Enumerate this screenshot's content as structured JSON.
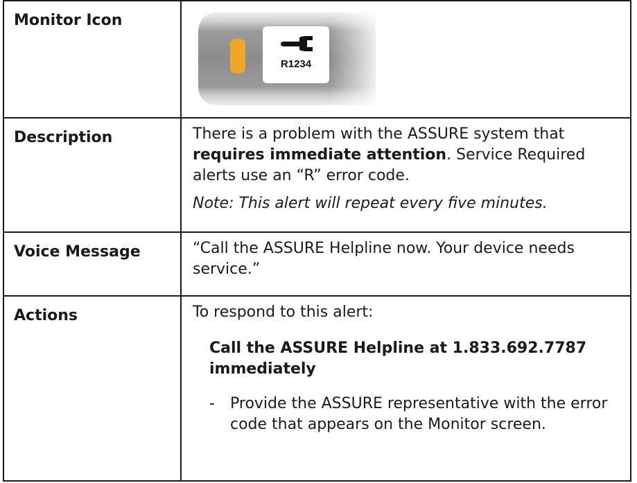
{
  "rows": {
    "monitor_icon": {
      "label": "Monitor Icon",
      "device": {
        "icon": "wrench-icon",
        "code": "R1234",
        "indicator_color": "#f0a52b",
        "body_color": "#8c8c8c",
        "screen_color": "#ffffff"
      }
    },
    "description": {
      "label": "Description",
      "text_before": "There is a problem with the ASSURE system that ",
      "text_bold": "requires immediate attention",
      "text_after": ". Service Required alerts use an “R” error code.",
      "note": "Note: This alert will repeat every five minutes."
    },
    "voice_message": {
      "label": "Voice Message",
      "text": "“Call the ASSURE Helpline now. Your device needs service.”"
    },
    "actions": {
      "label": "Actions",
      "intro": "To respond to this alert:",
      "primary": "Call the ASSURE Helpline at 1.833.692.7787 immediately",
      "step_marker": "-",
      "step": "Provide the ASSURE representative with the error code that appears on the Monitor screen."
    }
  }
}
